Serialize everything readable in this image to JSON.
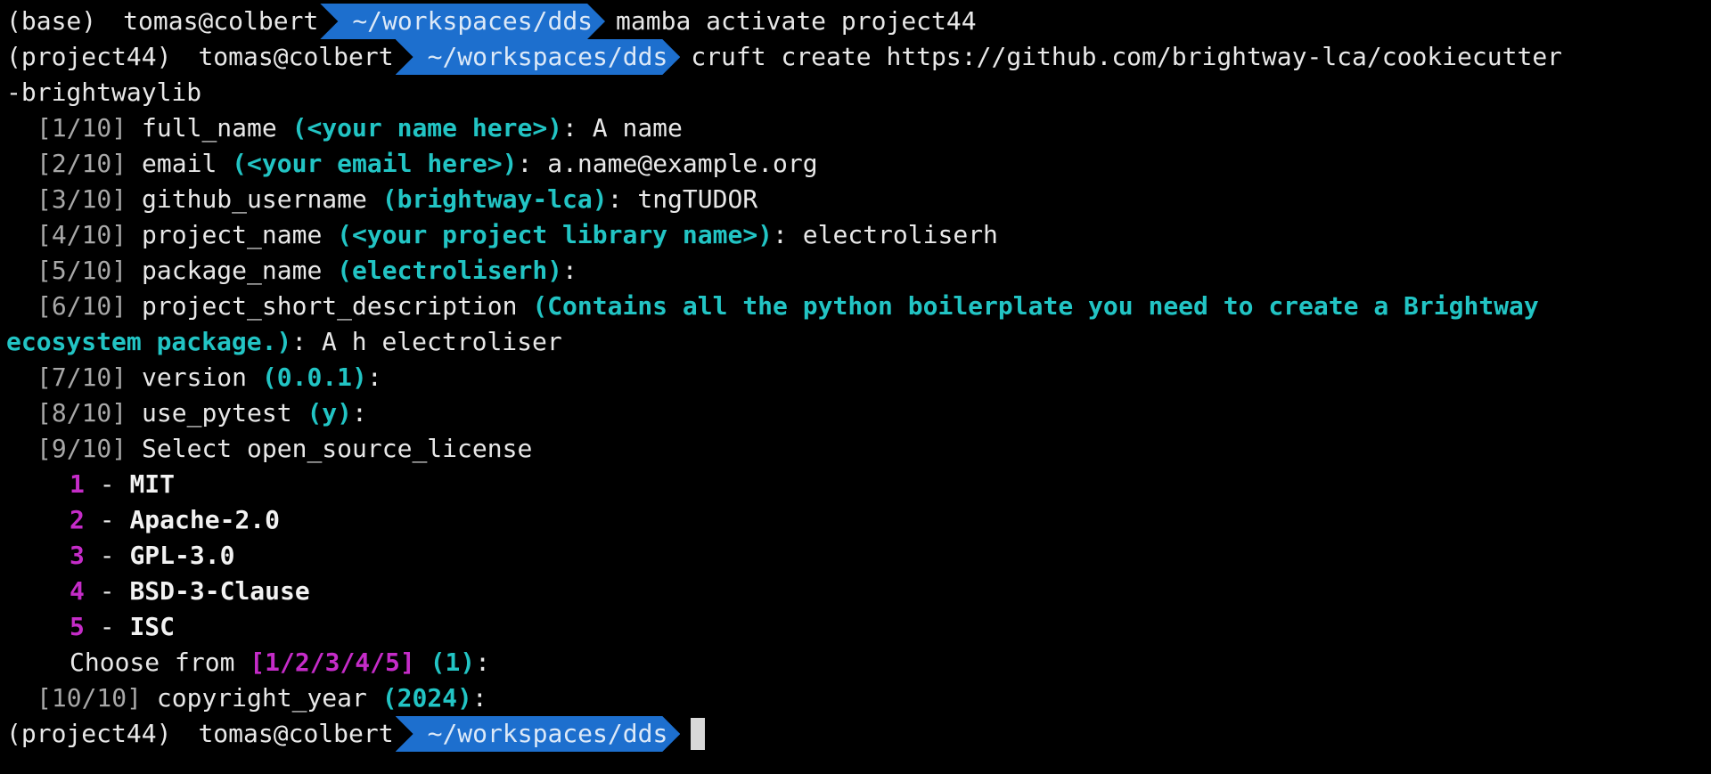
{
  "terminal": {
    "prompts": [
      {
        "env": "(base)",
        "user": "tomas@colbert",
        "path": "~/workspaces/dds",
        "command": "mamba activate project44"
      },
      {
        "env": "(project44)",
        "user": "tomas@colbert",
        "path": "~/workspaces/dds",
        "command": "cruft create https://github.com/brightway-lca/cookiecutter"
      },
      {
        "env": "(project44)",
        "user": "tomas@colbert",
        "path": "~/workspaces/dds",
        "command": ""
      }
    ],
    "command_wrap": "-brightwaylib",
    "questions": [
      {
        "step": "[1/10]",
        "name": "full_name",
        "default": "(<your name here>)",
        "answer": "A name"
      },
      {
        "step": "[2/10]",
        "name": "email",
        "default": "(<your email here>)",
        "answer": "a.name@example.org"
      },
      {
        "step": "[3/10]",
        "name": "github_username",
        "default": "(brightway-lca)",
        "answer": "tngTUDOR"
      },
      {
        "step": "[4/10]",
        "name": "project_name",
        "default": "(<your project library name>)",
        "answer": "electroliserh"
      },
      {
        "step": "[5/10]",
        "name": "package_name",
        "default": "(electroliserh)",
        "answer": ""
      },
      {
        "step": "[6/10]",
        "name": "project_short_description",
        "default_line1": "(Contains all the python boilerplate you need to create a Brightway",
        "default_line2": "ecosystem package.)",
        "answer": "A h electroliser"
      },
      {
        "step": "[7/10]",
        "name": "version",
        "default": "(0.0.1)",
        "answer": ""
      },
      {
        "step": "[8/10]",
        "name": "use_pytest",
        "default": "(y)",
        "answer": ""
      },
      {
        "step": "[9/10]",
        "name": "Select open_source_license"
      },
      {
        "step": "[10/10]",
        "name": "copyright_year",
        "default": "(2024)",
        "answer": ""
      }
    ],
    "licenses": [
      {
        "num": "1",
        "label": "MIT"
      },
      {
        "num": "2",
        "label": "Apache-2.0"
      },
      {
        "num": "3",
        "label": "GPL-3.0"
      },
      {
        "num": "4",
        "label": "BSD-3-Clause"
      },
      {
        "num": "5",
        "label": "ISC"
      }
    ],
    "choose": {
      "label": "Choose from",
      "range": "[1/2/3/4/5]",
      "default": "(1)"
    },
    "colors": {
      "background": "#000000",
      "text": "#e8e8e8",
      "step": "#a8a8a8",
      "default": "#22c4c4",
      "number": "#c52cc8",
      "path_segment": "#1d6fce"
    }
  }
}
